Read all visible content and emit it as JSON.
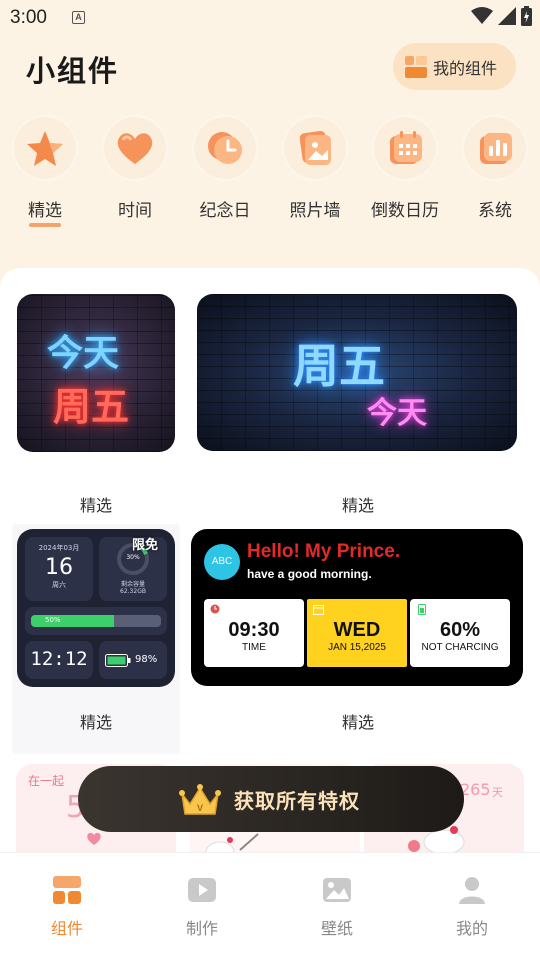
{
  "status_bar": {
    "time": "3:00",
    "a_badge": "A"
  },
  "header": {
    "title": "小组件",
    "my_widgets_label": "我的组件"
  },
  "categories": [
    {
      "label": "精选",
      "icon": "star-icon",
      "active": true
    },
    {
      "label": "时间",
      "icon": "heart-icon",
      "active": false
    },
    {
      "label": "纪念日",
      "icon": "clock-icon",
      "active": false
    },
    {
      "label": "照片墙",
      "icon": "photo-icon",
      "active": false
    },
    {
      "label": "倒数日历",
      "icon": "calendar-icon",
      "active": false
    },
    {
      "label": "系统",
      "icon": "chart-icon",
      "active": false
    }
  ],
  "cards": [
    {
      "label": "精选",
      "neon_line1": "今天",
      "neon_line2": "周五"
    },
    {
      "label": "精选",
      "neon_line1": "周五",
      "neon_line2": "今天"
    },
    {
      "label": "精选",
      "badge": "限免"
    },
    {
      "label": "精选"
    }
  ],
  "phone_widget": {
    "date_header": "2024年03月",
    "day": "16",
    "weekday": "周六",
    "storage_pct": "30%",
    "storage_label": "剩余容量",
    "storage_value": "62.32GB",
    "volume": "50%",
    "clock": "12:12",
    "battery": "98%"
  },
  "hello_widget": {
    "avatar": "ABC",
    "title": "Hello!  My Prince.",
    "subtitle": "have a good morning.",
    "cells": [
      {
        "big": "09:30",
        "small": "TIME"
      },
      {
        "big": "WED",
        "small": "JAN 15,2025"
      },
      {
        "big": "60%",
        "small": "NOT CHARCING"
      }
    ]
  },
  "peek_row": {
    "left_text": "在一起",
    "left_number": "5",
    "right_number": "265",
    "right_unit": "天"
  },
  "promo": {
    "label": "获取所有特权"
  },
  "bottom_nav": [
    {
      "label": "组件",
      "icon": "widgets-icon",
      "active": true
    },
    {
      "label": "制作",
      "icon": "play-icon",
      "active": false
    },
    {
      "label": "壁纸",
      "icon": "image-icon",
      "active": false
    },
    {
      "label": "我的",
      "icon": "user-icon",
      "active": false
    }
  ],
  "colors": {
    "accent": "#f08a32",
    "background": "#fdf3e4",
    "promo_text": "#fbe2b8"
  }
}
